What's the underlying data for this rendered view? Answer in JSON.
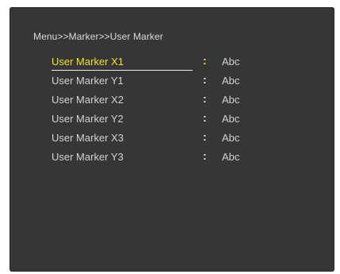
{
  "breadcrumb": "Menu>>Marker>>User Marker",
  "menu": {
    "items": [
      {
        "label": "User Marker X1",
        "value": "Abc"
      },
      {
        "label": "User Marker Y1",
        "value": "Abc"
      },
      {
        "label": "User Marker X2",
        "value": "Abc"
      },
      {
        "label": "User Marker Y2",
        "value": "Abc"
      },
      {
        "label": "User Marker X3",
        "value": "Abc"
      },
      {
        "label": "User Marker Y3",
        "value": "Abc"
      }
    ],
    "separator": ":",
    "selected_index": 0
  },
  "colors": {
    "panel_bg": "#363636",
    "text": "#d2d2d2",
    "highlight": "#f1e22b"
  }
}
